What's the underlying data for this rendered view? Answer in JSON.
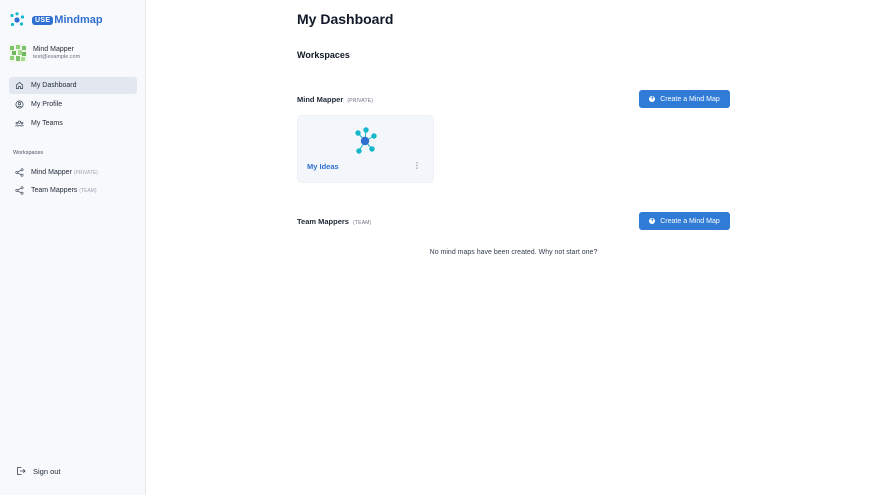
{
  "app": {
    "logo_badge": "USE",
    "logo_text": "Mindmap",
    "brand_color": "#2f6fd1",
    "accent_color": "#2f7bd6"
  },
  "user": {
    "name": "Mind Mapper",
    "email": "test@example.com"
  },
  "nav": {
    "items": [
      {
        "label": "My Dashboard",
        "icon": "home-icon",
        "active": true
      },
      {
        "label": "My Profile",
        "icon": "user-circle-icon",
        "active": false
      },
      {
        "label": "My Teams",
        "icon": "team-icon",
        "active": false
      }
    ]
  },
  "workspaces_nav": {
    "section_label": "Workspaces",
    "items": [
      {
        "label": "Mind Mapper",
        "tag": "(PRIVATE)",
        "icon": "share-icon"
      },
      {
        "label": "Team Mappers",
        "tag": "(TEAM)",
        "icon": "share-icon"
      }
    ]
  },
  "sign_out": "Sign out",
  "main": {
    "title": "My Dashboard",
    "subtitle": "Workspaces",
    "workspaces": [
      {
        "name": "Mind Mapper",
        "tag": "(PRIVATE)",
        "create_label": "Create a Mind Map",
        "maps": [
          {
            "title": "My Ideas",
            "menu": "⋮"
          }
        ]
      },
      {
        "name": "Team Mappers",
        "tag": "(TEAM)",
        "create_label": "Create a Mind Map",
        "empty_message": "No mind maps have been created. Why not start one?"
      }
    ]
  }
}
